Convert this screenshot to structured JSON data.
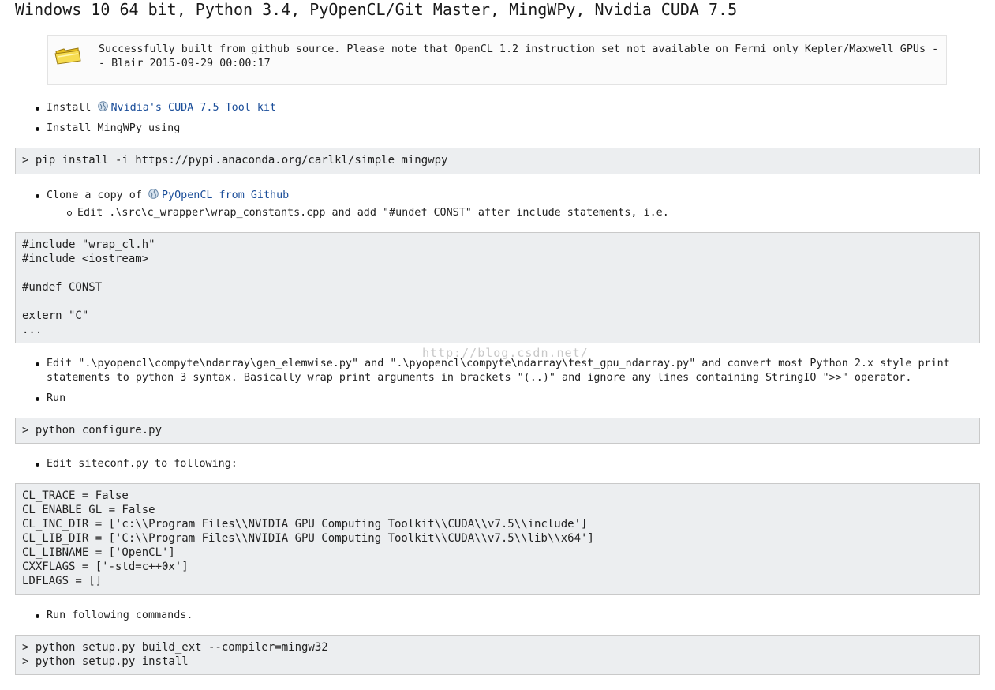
{
  "title": "Windows 10 64 bit, Python 3.4, PyOpenCL/Git Master, MingWPy, Nvidia CUDA 7.5",
  "note": {
    "icon": "folder-icon",
    "text": "Successfully built from github source. Please note that OpenCL 1.2 instruction set not available on Fermi only Kepler/Maxwell GPUs -- Blair 2015-09-29 00:00:17"
  },
  "steps": {
    "install_prefix": "Install ",
    "install_link": "Nvidia's CUDA 7.5 Tool kit",
    "install_mingwpy": "Install MingWPy using",
    "clone_prefix": "Clone a copy of ",
    "clone_link": "PyOpenCL from Github",
    "clone_sub": "Edit .\\src\\c_wrapper\\wrap_constants.cpp and add \"#undef CONST\" after include statements, i.e.",
    "edit_python": "Edit \".\\pyopencl\\compyte\\ndarray\\gen_elemwise.py\" and \".\\pyopencl\\compyte\\ndarray\\test_gpu_ndarray.py\" and convert most Python 2.x style print statements to python 3 syntax. Basically wrap print arguments in brackets \"(..)\" and ignore any lines containing StringIO \">>\" operator.",
    "run": "Run",
    "edit_siteconf": "Edit siteconf.py to following:",
    "run_following": "Run following commands."
  },
  "code": {
    "pip": "> pip install -i https://pypi.anaconda.org/carlkl/simple mingwpy",
    "cpp": "#include \"wrap_cl.h\"\n#include <iostream>\n\n#undef CONST\n\nextern \"C\"\n...",
    "configure": "> python configure.py",
    "siteconf": "CL_TRACE = False\nCL_ENABLE_GL = False\nCL_INC_DIR = ['c:\\\\Program Files\\\\NVIDIA GPU Computing Toolkit\\\\CUDA\\\\v7.5\\\\include']\nCL_LIB_DIR = ['C:\\\\Program Files\\\\NVIDIA GPU Computing Toolkit\\\\CUDA\\\\v7.5\\\\lib\\\\x64']\nCL_LIBNAME = ['OpenCL']\nCXXFLAGS = ['-std=c++0x']\nLDFLAGS = []",
    "setup": "> python setup.py build_ext --compiler=mingw32\n> python setup.py install"
  },
  "watermark": "http://blog.csdn.net/",
  "colors": {
    "link": "#1a4d99",
    "code_bg": "#eceef0",
    "code_border": "#c9c9c9"
  }
}
